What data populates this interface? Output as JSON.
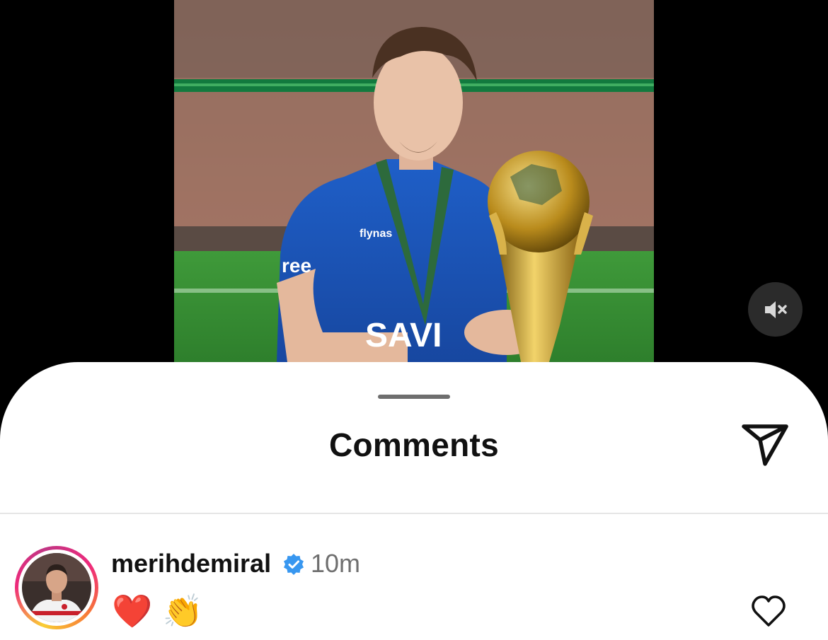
{
  "media": {
    "alt": "Player in blue Al Hilal kit holding a golden trophy in a stadium",
    "mute_icon": "speaker-muted-icon"
  },
  "sheet": {
    "title": "Comments",
    "share_icon": "paper-plane-icon"
  },
  "comments": [
    {
      "username": "merihdemiral",
      "verified": true,
      "time": "10m",
      "text": "❤️ 👏",
      "like_icon": "heart-outline-icon"
    }
  ],
  "colors": {
    "verified_blue": "#3897f0",
    "secondary_text": "#6f6f6f",
    "background_dark": "#000000"
  }
}
